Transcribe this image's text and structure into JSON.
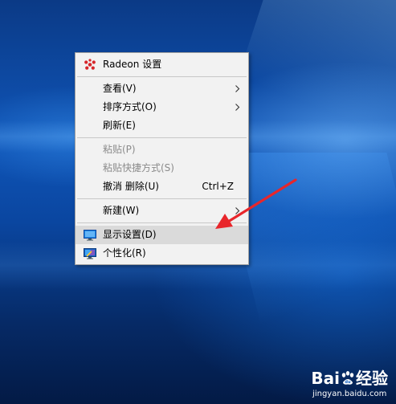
{
  "menu": {
    "items": [
      {
        "label": "Radeon 设置",
        "icon": "radeon-icon"
      },
      {
        "label": "查看(V)",
        "submenu": true
      },
      {
        "label": "排序方式(O)",
        "submenu": true
      },
      {
        "label": "刷新(E)"
      },
      {
        "label": "粘贴(P)",
        "disabled": true
      },
      {
        "label": "粘贴快捷方式(S)",
        "disabled": true
      },
      {
        "label": "撤消 删除(U)",
        "shortcut": "Ctrl+Z"
      },
      {
        "label": "新建(W)",
        "submenu": true
      },
      {
        "label": "显示设置(D)",
        "icon": "display-monitor-icon",
        "highlighted": true
      },
      {
        "label": "个性化(R)",
        "icon": "personalize-icon"
      }
    ]
  },
  "watermark": {
    "brand_a": "Bai",
    "brand_b": "经验",
    "url": "jingyan.baidu.com"
  },
  "colors": {
    "menu_bg": "#f2f2f2",
    "highlight": "#dadada",
    "disabled_text": "#8b8b8b",
    "arrow": "#e8262b",
    "radeon": "#d7262b"
  }
}
